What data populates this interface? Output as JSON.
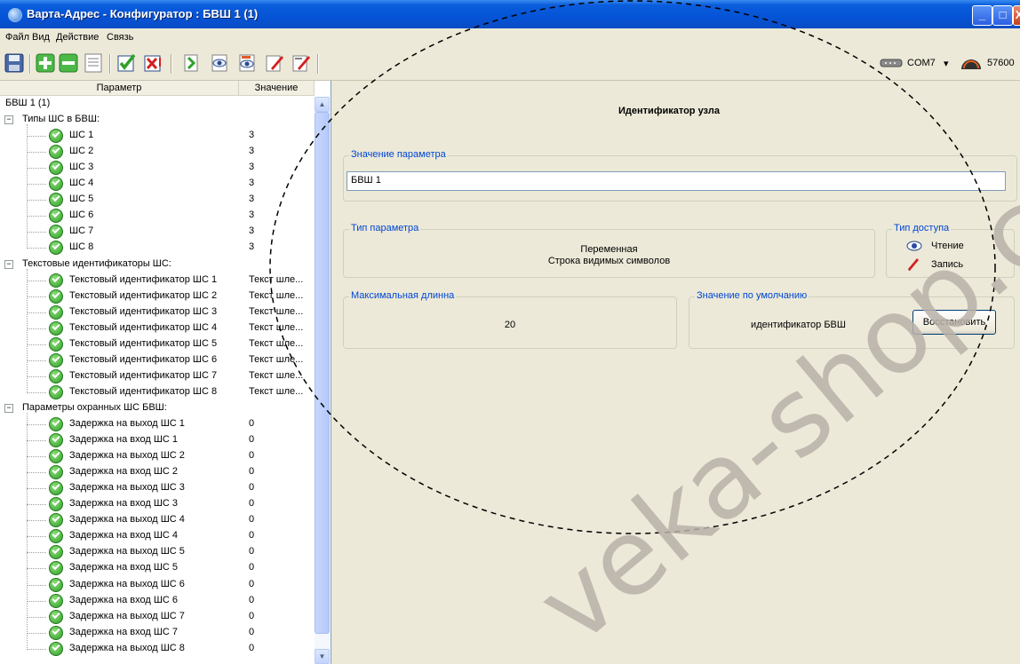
{
  "window": {
    "title": "Варта-Адрес - Конфигуратор : БВШ 1 (1)"
  },
  "menu": [
    "Файл",
    "Вид",
    "Действие",
    "Связь"
  ],
  "toolbar": {
    "icons": [
      "save-icon",
      "add-icon",
      "remove-icon",
      "list-icon",
      "check-icon",
      "cross-icon",
      "read-icon",
      "read-all-icon",
      "read-view-icon",
      "write-icon",
      "write-all-icon"
    ],
    "port": "COM7",
    "baud": "57600"
  },
  "tree": {
    "columns": {
      "param": "Параметр",
      "value": "Значение"
    },
    "root": "БВШ 1 (1)",
    "groups": [
      {
        "label": "Типы ШС в БВШ:",
        "items": [
          {
            "label": "ШС 1",
            "value": "3"
          },
          {
            "label": "ШС 2",
            "value": "3"
          },
          {
            "label": "ШС 3",
            "value": "3"
          },
          {
            "label": "ШС 4",
            "value": "3"
          },
          {
            "label": "ШС 5",
            "value": "3"
          },
          {
            "label": "ШС 6",
            "value": "3"
          },
          {
            "label": "ШС 7",
            "value": "3"
          },
          {
            "label": "ШС 8",
            "value": "3"
          }
        ]
      },
      {
        "label": "Текстовые идентификаторы ШС:",
        "items": [
          {
            "label": "Текстовый идентификатор ШС 1",
            "value": "Текст шле..."
          },
          {
            "label": "Текстовый идентификатор ШС 2",
            "value": "Текст шле..."
          },
          {
            "label": "Текстовый идентификатор ШС 3",
            "value": "Текст шле..."
          },
          {
            "label": "Текстовый идентификатор ШС 4",
            "value": "Текст шле..."
          },
          {
            "label": "Текстовый идентификатор ШС 5",
            "value": "Текст шле..."
          },
          {
            "label": "Текстовый идентификатор ШС 6",
            "value": "Текст шле..."
          },
          {
            "label": "Текстовый идентификатор ШС 7",
            "value": "Текст шле..."
          },
          {
            "label": "Текстовый идентификатор ШС 8",
            "value": "Текст шле..."
          }
        ]
      },
      {
        "label": "Параметры охранных ШС БВШ:",
        "items": [
          {
            "label": "Задержка на выход ШС 1",
            "value": "0"
          },
          {
            "label": "Задержка на вход ШС 1",
            "value": "0"
          },
          {
            "label": "Задержка на выход ШС 2",
            "value": "0"
          },
          {
            "label": "Задержка на вход ШС 2",
            "value": "0"
          },
          {
            "label": "Задержка на выход ШС 3",
            "value": "0"
          },
          {
            "label": "Задержка на вход ШС 3",
            "value": "0"
          },
          {
            "label": "Задержка на выход ШС 4",
            "value": "0"
          },
          {
            "label": "Задержка на вход ШС 4",
            "value": "0"
          },
          {
            "label": "Задержка на выход ШС 5",
            "value": "0"
          },
          {
            "label": "Задержка на вход ШС 5",
            "value": "0"
          },
          {
            "label": "Задержка на выход ШС 6",
            "value": "0"
          },
          {
            "label": "Задержка на вход ШС 6",
            "value": "0"
          },
          {
            "label": "Задержка на выход ШС 7",
            "value": "0"
          },
          {
            "label": "Задержка на вход ШС 7",
            "value": "0"
          },
          {
            "label": "Задержка на выход ШС 8",
            "value": "0"
          }
        ]
      }
    ]
  },
  "detail": {
    "heading": "Идентификатор узла",
    "value_group": "Значение параметра",
    "value": "БВШ 1",
    "type_group": "Тип параметра",
    "type_line1": "Переменная",
    "type_line2": "Строка видимых символов",
    "access_group": "Тип доступа",
    "access_read": "Чтение",
    "access_write": "Запись",
    "maxlen_group": "Максимальная длинна",
    "maxlen_value": "20",
    "default_group": "Значение по умолчанию",
    "default_value": "идентификатор БВШ",
    "restore_button": "Восстановить"
  },
  "watermark": "veka-shop.com",
  "colors": {
    "titlebar": "#0553d6",
    "legend": "#0046d5",
    "ok_icon": "#2f9c2a",
    "watermark": "#b8b0a8"
  }
}
